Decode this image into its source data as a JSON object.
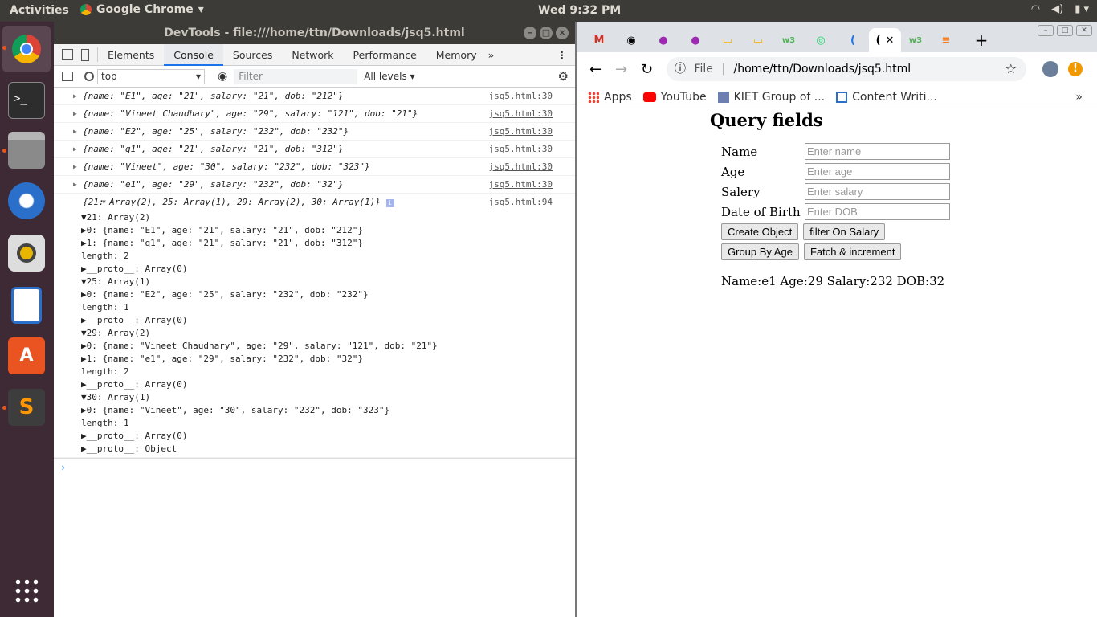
{
  "topbar": {
    "activities": "Activities",
    "app": "Google Chrome",
    "clock": "Wed  9:32 PM"
  },
  "devtools": {
    "title": "DevTools - file:///home/ttn/Downloads/jsq5.html",
    "tabs": [
      "Elements",
      "Console",
      "Sources",
      "Network",
      "Performance",
      "Memory"
    ],
    "context": "top",
    "filter_placeholder": "Filter",
    "levels": "All levels"
  },
  "console_rows": [
    {
      "text": "{name: \"E1\", age: \"21\", salary: \"21\", dob: \"212\"}",
      "src": "jsq5.html:30"
    },
    {
      "text": "{name: \"Vineet Chaudhary\", age: \"29\", salary: \"121\", dob: \"21\"}",
      "src": "jsq5.html:30"
    },
    {
      "text": "{name: \"E2\", age: \"25\", salary: \"232\", dob: \"232\"}",
      "src": "jsq5.html:30"
    },
    {
      "text": "{name: \"q1\", age: \"21\", salary: \"21\", dob: \"312\"}",
      "src": "jsq5.html:30"
    },
    {
      "text": "{name: \"Vineet\", age: \"30\", salary: \"232\", dob: \"323\"}",
      "src": "jsq5.html:30"
    },
    {
      "text": "{name: \"e1\", age: \"29\", salary: \"232\", dob: \"32\"}",
      "src": "jsq5.html:30"
    }
  ],
  "grouped": {
    "summary": "{21: Array(2), 25: Array(1), 29: Array(2), 30: Array(1)}",
    "src": "jsq5.html:94",
    "lines": [
      "▼21: Array(2)",
      "  ▶0: {name: \"E1\", age: \"21\", salary: \"21\", dob: \"212\"}",
      "  ▶1: {name: \"q1\", age: \"21\", salary: \"21\", dob: \"312\"}",
      "    length: 2",
      "  ▶__proto__: Array(0)",
      "▼25: Array(1)",
      "  ▶0: {name: \"E2\", age: \"25\", salary: \"232\", dob: \"232\"}",
      "    length: 1",
      "  ▶__proto__: Array(0)",
      "▼29: Array(2)",
      "  ▶0: {name: \"Vineet Chaudhary\", age: \"29\", salary: \"121\", dob: \"21\"}",
      "  ▶1: {name: \"e1\", age: \"29\", salary: \"232\", dob: \"32\"}",
      "    length: 2",
      "  ▶__proto__: Array(0)",
      "▼30: Array(1)",
      "  ▶0: {name: \"Vineet\", age: \"30\", salary: \"232\", dob: \"323\"}",
      "    length: 1",
      "  ▶__proto__: Array(0)",
      "▶__proto__: Object"
    ]
  },
  "chrome": {
    "address_scheme": "File",
    "address": "/home/ttn/Downloads/jsq5.html",
    "bookmarks": [
      "Apps",
      "YouTube",
      "KIET Group of ...",
      "Content Writi..."
    ]
  },
  "page": {
    "heading": "Query fields",
    "fields": [
      {
        "label": "Name",
        "placeholder": "Enter name"
      },
      {
        "label": "Age",
        "placeholder": "Enter age"
      },
      {
        "label": "Salery",
        "placeholder": "Enter salary"
      },
      {
        "label": "Date of Birth",
        "placeholder": "Enter DOB"
      }
    ],
    "buttons": [
      "Create Object",
      "filter On Salary",
      "Group By Age",
      "Fatch & increment"
    ],
    "result": "Name:e1 Age:29 Salary:232 DOB:32"
  }
}
